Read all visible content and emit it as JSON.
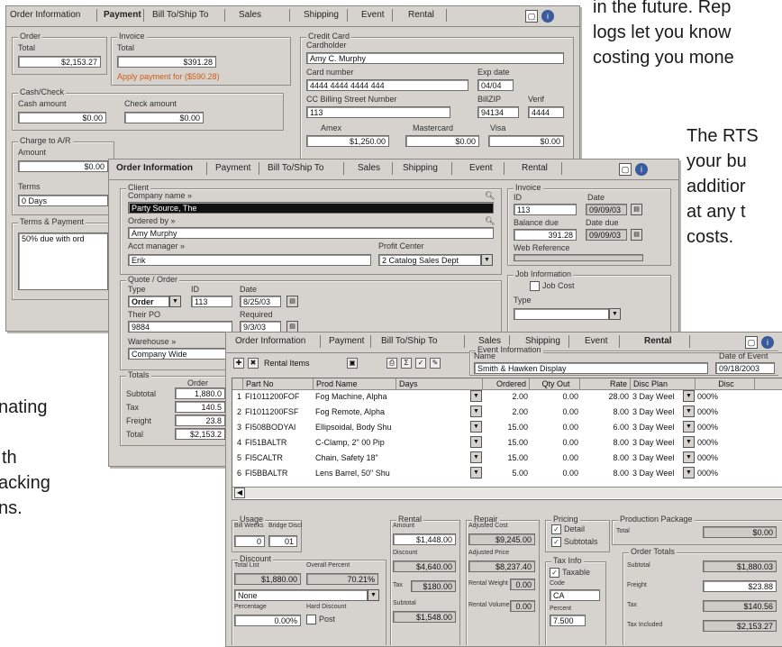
{
  "prose": {
    "top_right": [
      "in the future.  Rep",
      "logs let you know",
      "costing you mone"
    ],
    "mid_right": [
      "The RTS",
      "your bu",
      "additior",
      "at any t",
      "costs."
    ],
    "left": [
      "nating",
      "th",
      "acking",
      "ns."
    ]
  },
  "win1": {
    "tabs": [
      "Order Information",
      "Payment",
      "Bill To/Ship To",
      "Sales",
      "Shipping",
      "Event",
      "Rental"
    ],
    "order": {
      "title": "Order",
      "total_label": "Total",
      "total": "$2,153.27"
    },
    "invoice": {
      "title": "Invoice",
      "total_label": "Total",
      "total": "$391.28",
      "apply_link": "Apply payment for ($590.28)"
    },
    "cash": {
      "title": "Cash/Check",
      "cash_label": "Cash amount",
      "cash_value": "$0.00",
      "check_label": "Check amount",
      "check_value": "$0.00"
    },
    "charge": {
      "title": "Charge to A/R",
      "amount_label": "Amount",
      "amount": "$0.00",
      "terms_label": "Terms",
      "terms": "0 Days"
    },
    "terms_payment": {
      "title": "Terms & Payment",
      "note": "50% due with ord"
    },
    "credit": {
      "title": "Credit Card",
      "cardholder_label": "Cardholder",
      "cardholder": "Amy C. Murphy",
      "card_number_label": "Card number",
      "card_number": "4444 4444 4444 444",
      "exp_label": "Exp date",
      "exp": "04/04",
      "street_label": "CC Billing Street Number",
      "street": "113",
      "zip_label": "BillZIP",
      "zip": "94134",
      "verif_label": "Verif",
      "verif": "4444",
      "amex_label": "Amex",
      "amex": "$1,250.00",
      "mc_label": "Mastercard",
      "mc": "$0.00",
      "visa_label": "Visa",
      "visa": "$0.00"
    }
  },
  "win2": {
    "tabs": [
      "Order Information",
      "Payment",
      "Bill To/Ship To",
      "Sales",
      "Shipping",
      "Event",
      "Rental"
    ],
    "client": {
      "title": "Client",
      "company_label": "Company name »",
      "company": "Party Source, The",
      "ordered_label": "Ordered by »",
      "ordered": "Amy Murphy",
      "manager_label": "Acct manager »",
      "manager": "Erik",
      "profit_label": "Profit Center",
      "profit": "2 Catalog Sales Dept"
    },
    "quote": {
      "title": "Quote / Order",
      "type_label": "Type",
      "type": "Order",
      "id_label": "ID",
      "id": "113",
      "date_label": "Date",
      "date": "8/25/03",
      "po_label": "Their PO",
      "po": "9884",
      "req_label": "Required",
      "req": "9/3/03",
      "wh_label": "Warehouse »",
      "wh": "Company Wide"
    },
    "totals": {
      "title": "Totals",
      "col_label": "Order",
      "rows": [
        {
          "label": "Subtotal",
          "value": "1,880.0"
        },
        {
          "label": "Tax",
          "value": "140.5"
        },
        {
          "label": "Freight",
          "value": "23.8"
        },
        {
          "label": "Total",
          "value": "$2,153.2"
        }
      ]
    },
    "invoice": {
      "title": "Invoice",
      "id_label": "ID",
      "id": "113",
      "date_label": "Date",
      "date": "09/09/03",
      "balance_label": "Balance due",
      "balance": "391.28",
      "datedue_label": "Date due",
      "datedue": "09/09/03",
      "web_label": "Web Reference"
    },
    "job": {
      "title": "Job Information",
      "jobcost_label": "Job Cost",
      "type_label": "Type"
    }
  },
  "win3": {
    "tabs": [
      "Order Information",
      "Payment",
      "Bill To/Ship To",
      "Sales",
      "Shipping",
      "Event",
      "Rental"
    ],
    "toolbar_label": "Rental Items",
    "event": {
      "title": "Event Information",
      "name_label": "Name",
      "name": "Smith & Hawken Display",
      "date_label": "Date of Event",
      "date": "09/18/2003"
    },
    "columns": [
      "Part No",
      "Prod Name",
      "Days",
      "Ordered",
      "Qty Out",
      "Rate",
      "Disc Plan",
      "Disc"
    ],
    "rows": [
      {
        "n": "1",
        "part": "FI1011200FOF",
        "name": "Fog Machine, Alpha",
        "ordered": "2.00",
        "out": "0.00",
        "rate": "28.00",
        "plan": "3 Day Weel",
        "disc": "000%"
      },
      {
        "n": "2",
        "part": "FI1011200FSF",
        "name": "Fog Remote, Alpha",
        "ordered": "2.00",
        "out": "0.00",
        "rate": "8.00",
        "plan": "3 Day Weel",
        "disc": "000%"
      },
      {
        "n": "3",
        "part": "FI508BODYAI",
        "name": "Ellipsoidal, Body Shu",
        "ordered": "15.00",
        "out": "0.00",
        "rate": "6.00",
        "plan": "3 Day Weel",
        "disc": "000%"
      },
      {
        "n": "4",
        "part": "FI51BALTR",
        "name": "C-Clamp, 2\" 00 Pip",
        "ordered": "15.00",
        "out": "0.00",
        "rate": "8.00",
        "plan": "3 Day Weel",
        "disc": "000%"
      },
      {
        "n": "5",
        "part": "FI5CALTR",
        "name": "Chain, Safety 18\"",
        "ordered": "15.00",
        "out": "0.00",
        "rate": "8.00",
        "plan": "3 Day Weel",
        "disc": "000%"
      },
      {
        "n": "6",
        "part": "FI5BBALTR",
        "name": "Lens Barrel, 50\" Shu",
        "ordered": "5.00",
        "out": "0.00",
        "rate": "8.00",
        "plan": "3 Day Weel",
        "disc": "000%"
      }
    ],
    "usage": {
      "title": "Usage",
      "bill_label": "Bill Weeks",
      "bill": "0",
      "bridge_label": "Bridge Discl",
      "bridge": "01"
    },
    "discount": {
      "title": "Discount",
      "list_label": "Total List",
      "list": "$1,880.00",
      "pct_label": "Overall Percent",
      "pct": "70.21%",
      "select": "None",
      "perc_label": "Percentage",
      "hard_label": "Hard Discount",
      "perc": "0.00%",
      "post_label": "Post"
    },
    "rental": {
      "title": "Rental",
      "amount_label": "Amount",
      "amount": "$1,448.00",
      "discount_label": "Discount",
      "discount": "$4,640.00",
      "tax_label": "Tax",
      "tax": "$180.00",
      "subtotal_label": "Subtotal",
      "subtotal": "$1,548.00"
    },
    "repair": {
      "title": "Repair",
      "cost_label": "Adjusted Cost",
      "cost": "$9,245.00",
      "price_label": "Adjusted Price",
      "price": "$8,237.40",
      "weight_label": "Rental Weight",
      "weight": "0.00",
      "volume_label": "Rental Volume",
      "volume": "0.00"
    },
    "pricing": {
      "title": "Pricing",
      "detail_label": "Detail",
      "subtotals_label": "Subtotals"
    },
    "taxinfo": {
      "title": "Tax Info",
      "taxable_label": "Taxable",
      "code_label": "Code",
      "code": "CA",
      "percent_label": "Percent",
      "percent": "7.500"
    },
    "production": {
      "title": "Production Package",
      "total_label": "Total",
      "total": "$0.00"
    },
    "order_totals": {
      "title": "Order Totals",
      "rows": [
        {
          "label": "Subtotal",
          "value": "$1,880.03"
        },
        {
          "label": "Freight",
          "value": "$23.88"
        },
        {
          "label": "Tax",
          "value": "$140.56"
        },
        {
          "label": "Tax Included",
          "value": "$2,153.27"
        }
      ]
    }
  }
}
